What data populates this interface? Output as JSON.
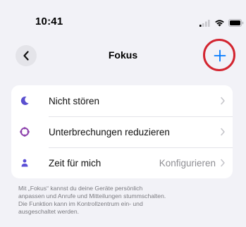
{
  "status_bar": {
    "time": "10:41"
  },
  "nav": {
    "title": "Fokus",
    "back_icon": "chevron-left-icon",
    "add_icon": "plus-icon"
  },
  "focus_modes": [
    {
      "label": "Nicht stören",
      "detail": "",
      "icon": "moon-icon",
      "icon_color": "#5a4fcf"
    },
    {
      "label": "Unterbrechungen reduzieren",
      "detail": "",
      "icon": "flower-icon",
      "icon_color": "#8e44ad"
    },
    {
      "label": "Zeit für mich",
      "detail": "Konfigurieren",
      "icon": "person-icon",
      "icon_color": "#5b4fd6"
    }
  ],
  "footer_lines": [
    "Mit „Fokus“ kannst du deine Geräte persönlich",
    "anpassen und Anrufe und Mitteilungen stummschalten.",
    "Die Funktion kann im Kontrollzentrum ein- und",
    "ausgeschaltet werden."
  ],
  "colors": {
    "accent": "#007aff",
    "highlight_ring": "#d32530",
    "background": "#f2f2f7"
  }
}
